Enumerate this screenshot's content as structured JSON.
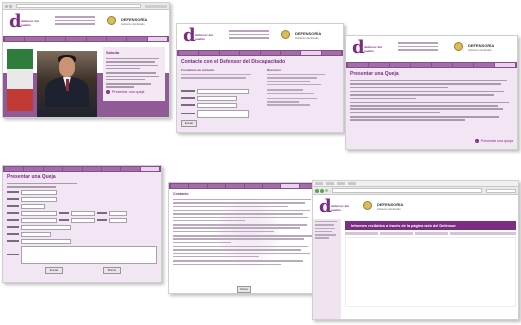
{
  "branding": {
    "logo_letter": "d",
    "logo_sub": "defensor del pueblo",
    "gov_title": "DEFENSORÍA",
    "gov_subtitle": "Gobierno del Estado"
  },
  "nav": {
    "items": [
      "Inicio",
      "Quién Es",
      "Funciones",
      "Organización",
      "Normativa",
      "Informes",
      "Publicaciones",
      "Contacto",
      "Presentar una Queja"
    ]
  },
  "screens": {
    "s1": {
      "heading": "Saluda",
      "link_label": "Presentar una queja"
    },
    "s2": {
      "title": "Contacte con el Defensor del Discapacitado",
      "form_heading": "Formulario de contacto",
      "right_heading": "Dirección",
      "submit_label": "Enviar"
    },
    "s3": {
      "title": "Presentar una Queja",
      "link_label": "Presentar una queja"
    },
    "s4": {
      "title": "Presentar una Queja",
      "send_label": "Enviar",
      "clear_label": "Borrar"
    },
    "s5": {
      "heading": "Contacto",
      "footer_link": "Volver"
    },
    "s6": {
      "banner": "Informes recibidos a través de la página web del Defensor"
    }
  }
}
